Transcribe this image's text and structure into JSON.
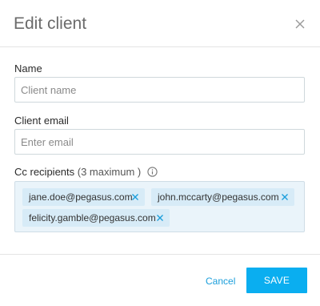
{
  "dialog": {
    "title": "Edit client",
    "close_icon": "close-icon"
  },
  "form": {
    "name": {
      "label": "Name",
      "value": "",
      "placeholder": "Client name"
    },
    "email": {
      "label": "Client email",
      "value": "",
      "placeholder": "Enter email"
    },
    "cc": {
      "label": "Cc recipients",
      "note": "(3 maximum )",
      "info_icon": "info-icon",
      "recipients": [
        "jane.doe@pegasus.com",
        "john.mccarty@pegasus.com",
        "felicity.gamble@pegasus.com"
      ],
      "remove_icon": "close-icon"
    }
  },
  "footer": {
    "cancel_label": "Cancel",
    "save_label": "SAVE"
  },
  "colors": {
    "accent": "#0aaef0",
    "link": "#1a9edb",
    "chip_bg": "#d7ebf7",
    "chip_area_bg": "#eaf4fa"
  }
}
